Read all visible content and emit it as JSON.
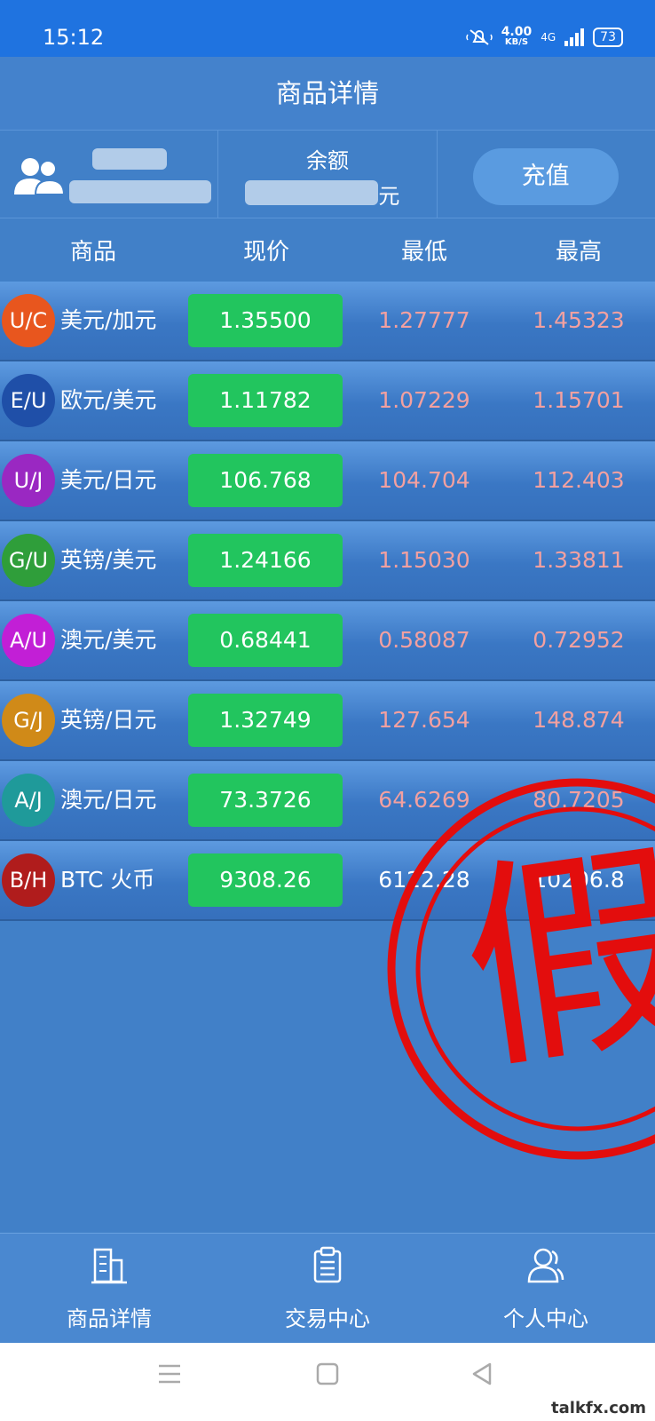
{
  "status_bar": {
    "time": "15:12",
    "net_speed": "4.00",
    "net_unit": "KB/S",
    "network": "4G",
    "battery": "73"
  },
  "header": {
    "title": "商品详情"
  },
  "account": {
    "balance_label": "余额",
    "balance_unit": "元",
    "recharge_label": "充值"
  },
  "table": {
    "headers": [
      "商品",
      "现价",
      "最低",
      "最高"
    ],
    "rows": [
      {
        "code": "U/C",
        "name": "美元/加元",
        "price": "1.35500",
        "low": "1.27777",
        "high": "1.45323",
        "color": "#e8561e"
      },
      {
        "code": "E/U",
        "name": "欧元/美元",
        "price": "1.11782",
        "low": "1.07229",
        "high": "1.15701",
        "color": "#1f4fa8"
      },
      {
        "code": "U/J",
        "name": "美元/日元",
        "price": "106.768",
        "low": "104.704",
        "high": "112.403",
        "color": "#9a28c2"
      },
      {
        "code": "G/U",
        "name": "英镑/美元",
        "price": "1.24166",
        "low": "1.15030",
        "high": "1.33811",
        "color": "#2f9e3a"
      },
      {
        "code": "A/U",
        "name": "澳元/美元",
        "price": "0.68441",
        "low": "0.58087",
        "high": "0.72952",
        "color": "#c21fd6"
      },
      {
        "code": "G/J",
        "name": "英镑/日元",
        "price": "1.32749",
        "low": "127.654",
        "high": "148.874",
        "color": "#d08a18"
      },
      {
        "code": "A/J",
        "name": "澳元/日元",
        "price": "73.3726",
        "low": "64.6269",
        "high": "80.7205",
        "color": "#1f9a9a"
      },
      {
        "code": "B/H",
        "name": "BTC 火币",
        "price": "9308.26",
        "low": "6122.28",
        "high": "10206.8",
        "color": "#b01c1c"
      }
    ]
  },
  "stamp": {
    "text": "假",
    "color": "#e30d0d"
  },
  "bottom_nav": [
    {
      "label": "商品详情",
      "icon": "building-icon"
    },
    {
      "label": "交易中心",
      "icon": "clipboard-icon"
    },
    {
      "label": "个人中心",
      "icon": "user-icon"
    }
  ],
  "watermark": "talkfx.com"
}
